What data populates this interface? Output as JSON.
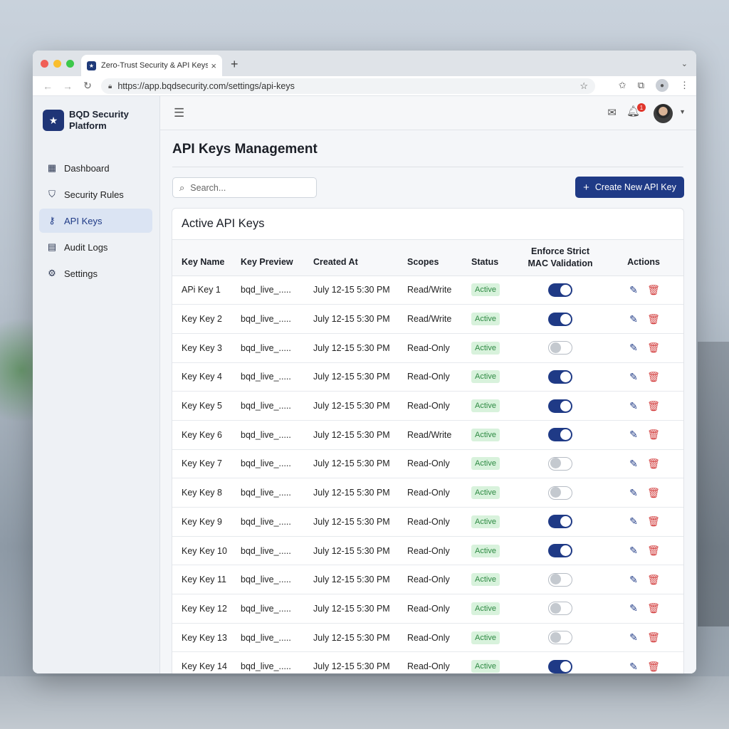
{
  "browser": {
    "tab_title": "Zero-Trust Security & API Keys",
    "url": "https://app.bqdsecurity.com/settings/api-keys"
  },
  "brand": {
    "name": "BQD Security Platform"
  },
  "sidebar": {
    "items": [
      {
        "label": "Dashboard",
        "icon": "dashboard-icon",
        "active": false
      },
      {
        "label": "Security Rules",
        "icon": "shield-icon",
        "active": false
      },
      {
        "label": "API Keys",
        "icon": "key-icon",
        "active": true
      },
      {
        "label": "Audit Logs",
        "icon": "document-icon",
        "active": false
      },
      {
        "label": "Settings",
        "icon": "gear-icon",
        "active": false
      }
    ]
  },
  "topbar": {
    "notification_count": "1"
  },
  "page": {
    "title": "API Keys Management",
    "search_placeholder": "Search...",
    "create_button": "Create New API Key"
  },
  "table": {
    "title": "Active API Keys",
    "headers": [
      "Key Name",
      "Key Preview",
      "Created At",
      "Scopes",
      "Status",
      "Enforce Strict MAC Validation",
      "Actions"
    ],
    "rows": [
      {
        "name": "APi Key 1",
        "preview": "bqd_live_.....",
        "created": "July 12-15 5:30 PM",
        "scopes": "Read/Write",
        "status": "Active",
        "mac": true
      },
      {
        "name": "Key Key 2",
        "preview": "bqd_live_.....",
        "created": "July 12-15 5:30 PM",
        "scopes": "Read/Write",
        "status": "Active",
        "mac": true
      },
      {
        "name": "Key Key 3",
        "preview": "bqd_live_.....",
        "created": "July 12-15 5:30 PM",
        "scopes": "Read-Only",
        "status": "Active",
        "mac": false
      },
      {
        "name": "Key Key 4",
        "preview": "bqd_live_.....",
        "created": "July 12-15 5:30 PM",
        "scopes": "Read-Only",
        "status": "Active",
        "mac": true
      },
      {
        "name": "Key Key 5",
        "preview": "bqd_live_.....",
        "created": "July 12-15 5:30 PM",
        "scopes": "Read-Only",
        "status": "Active",
        "mac": true
      },
      {
        "name": "Key Key 6",
        "preview": "bqd_live_.....",
        "created": "July 12-15 5:30 PM",
        "scopes": "Read/Write",
        "status": "Active",
        "mac": true
      },
      {
        "name": "Key Key 7",
        "preview": "bqd_live_.....",
        "created": "July 12-15 5:30 PM",
        "scopes": "Read-Only",
        "status": "Active",
        "mac": false
      },
      {
        "name": "Key Key 8",
        "preview": "bqd_live_.....",
        "created": "July 12-15 5:30 PM",
        "scopes": "Read-Only",
        "status": "Active",
        "mac": false
      },
      {
        "name": "Key Key 9",
        "preview": "bqd_live_.....",
        "created": "July 12-15 5:30 PM",
        "scopes": "Read-Only",
        "status": "Active",
        "mac": true
      },
      {
        "name": "Key Key 10",
        "preview": "bqd_live_.....",
        "created": "July 12-15 5:30 PM",
        "scopes": "Read-Only",
        "status": "Active",
        "mac": true
      },
      {
        "name": "Key Key 11",
        "preview": "bqd_live_.....",
        "created": "July 12-15 5:30 PM",
        "scopes": "Read-Only",
        "status": "Active",
        "mac": false
      },
      {
        "name": "Key Key 12",
        "preview": "bqd_live_.....",
        "created": "July 12-15 5:30 PM",
        "scopes": "Read-Only",
        "status": "Active",
        "mac": false
      },
      {
        "name": "Key Key 13",
        "preview": "bqd_live_.....",
        "created": "July 12-15 5:30 PM",
        "scopes": "Read-Only",
        "status": "Active",
        "mac": false
      },
      {
        "name": "Key Key 14",
        "preview": "bqd_live_.....",
        "created": "July 12-15 5:30 PM",
        "scopes": "Read-Only",
        "status": "Active",
        "mac": true
      }
    ]
  },
  "colors": {
    "accent": "#1f3a86",
    "danger": "#d23b3b",
    "success_bg": "#d8f2dc",
    "success_text": "#2e8a43"
  }
}
